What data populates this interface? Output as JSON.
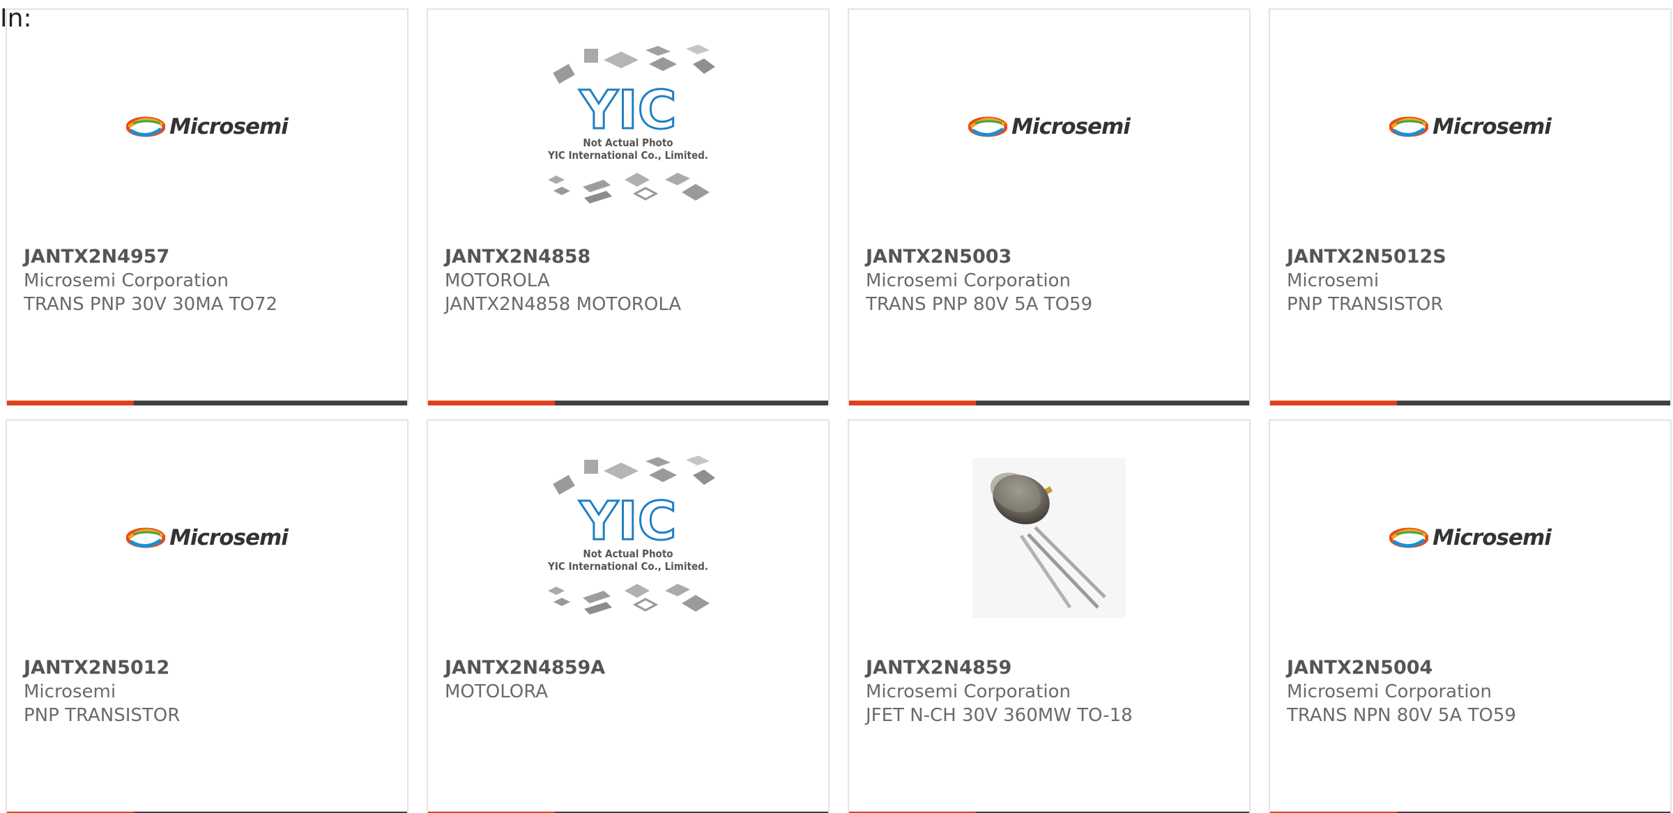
{
  "header": {
    "in_label": "In:"
  },
  "images": {
    "microsemi_logo_text": "Microsemi",
    "yic_logo_text": "YIC",
    "yic_caption_line1": "Not Actual Photo",
    "yic_caption_line2": "YIC International Co., Limited."
  },
  "colors": {
    "accent": "#e0401c",
    "bar": "#404040",
    "border": "#e3e3e3"
  },
  "products": [
    {
      "part_number": "JANTX2N4957",
      "manufacturer": "Microsemi Corporation",
      "description": "TRANS PNP 30V 30MA TO72",
      "image": "microsemi-logo"
    },
    {
      "part_number": "JANTX2N4858",
      "manufacturer": "MOTOROLA",
      "description": "JANTX2N4858 MOTOROLA",
      "image": "yic-placeholder"
    },
    {
      "part_number": "JANTX2N5003",
      "manufacturer": "Microsemi Corporation",
      "description": "TRANS PNP 80V 5A TO59",
      "image": "microsemi-logo"
    },
    {
      "part_number": "JANTX2N5012S",
      "manufacturer": "Microsemi",
      "description": "PNP TRANSISTOR",
      "image": "microsemi-logo"
    },
    {
      "part_number": "JANTX2N5012",
      "manufacturer": "Microsemi",
      "description": "PNP TRANSISTOR",
      "image": "microsemi-logo"
    },
    {
      "part_number": "JANTX2N4859A",
      "manufacturer": "MOTOLORA",
      "description": "",
      "image": "yic-placeholder"
    },
    {
      "part_number": "JANTX2N4859",
      "manufacturer": "Microsemi Corporation",
      "description": "JFET N-CH 30V 360MW TO-18",
      "image": "to18-transistor-photo"
    },
    {
      "part_number": "JANTX2N5004",
      "manufacturer": "Microsemi Corporation",
      "description": "TRANS NPN 80V 5A TO59",
      "image": "microsemi-logo"
    }
  ]
}
